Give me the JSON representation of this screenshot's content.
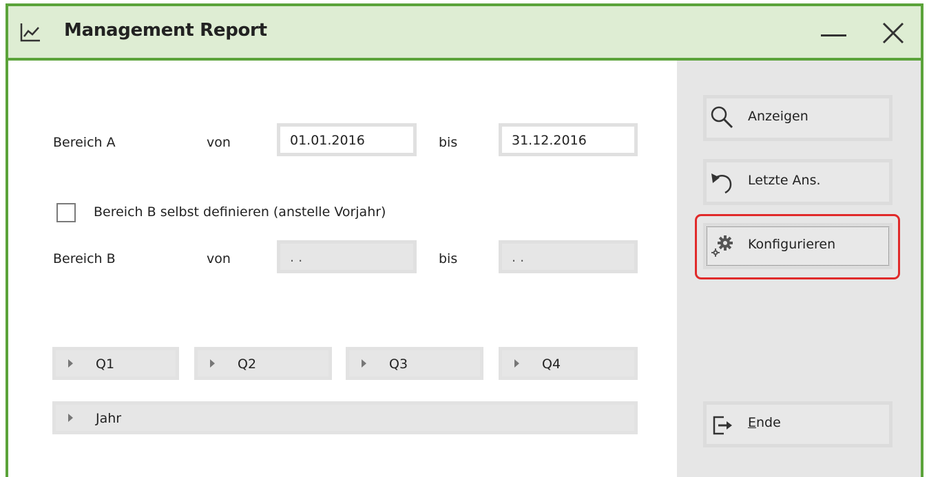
{
  "window": {
    "title": "Management Report",
    "title_icon": "line-chart-icon",
    "minimize_icon": "minimize-icon",
    "close_icon": "close-icon",
    "accent_color": "#5ba33a",
    "titlebar_color": "#deedd3"
  },
  "form": {
    "range_a": {
      "label": "Bereich A",
      "from_label": "von",
      "from_value": "01.01.2016",
      "to_label": "bis",
      "to_value": "31.12.2016"
    },
    "custom_range_b": {
      "label": "Bereich B selbst definieren (anstelle Vorjahr)",
      "checked": false
    },
    "range_b": {
      "label": "Bereich B",
      "from_label": "von",
      "from_value": " .  .",
      "to_label": "bis",
      "to_value": " .  ."
    },
    "quarters": [
      "Q1",
      "Q2",
      "Q3",
      "Q4"
    ],
    "year": "Jahr"
  },
  "sidebar": {
    "show": {
      "label": "Anzeigen",
      "icon": "search-icon"
    },
    "last_view": {
      "label": "Letzte Ans.",
      "icon": "undo-icon"
    },
    "configure": {
      "label": "Konfigurieren",
      "icon": "gears-icon"
    },
    "end": {
      "label_underlined": "E",
      "label_rest": "nde",
      "icon": "exit-icon"
    },
    "highlight_color": "#e02a2a"
  }
}
